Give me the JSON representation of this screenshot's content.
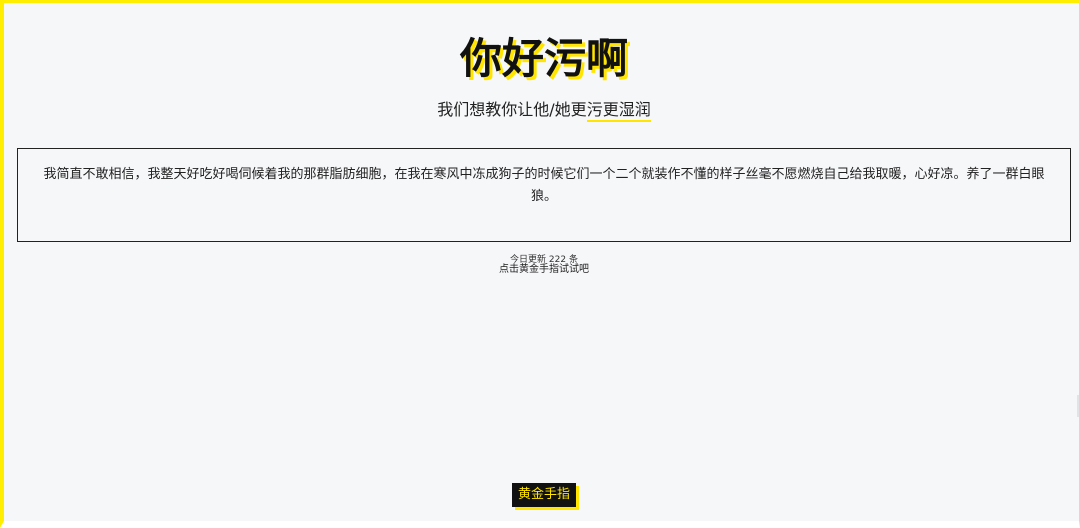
{
  "header": {
    "title": "你好污啊",
    "subtitle_prefix": "我们想教你让他/她更",
    "subtitle_highlight": "污更湿润"
  },
  "quote": {
    "text": "我简直不敢相信，我整天好吃好喝伺候着我的那群脂肪细胞，在我在寒风中冻成狗子的时候它们一个二个就装作不懂的样子丝毫不愿燃烧自己给我取暖，心好凉。养了一群白眼狼。"
  },
  "stats": {
    "update_text": "今日更新 222 条",
    "hint_text": "点击黄金手指试试吧"
  },
  "actions": {
    "gold_finger_label": "黄金手指"
  },
  "colors": {
    "accent": "#ffe500",
    "background": "#f6f7f9",
    "text": "#222222"
  }
}
